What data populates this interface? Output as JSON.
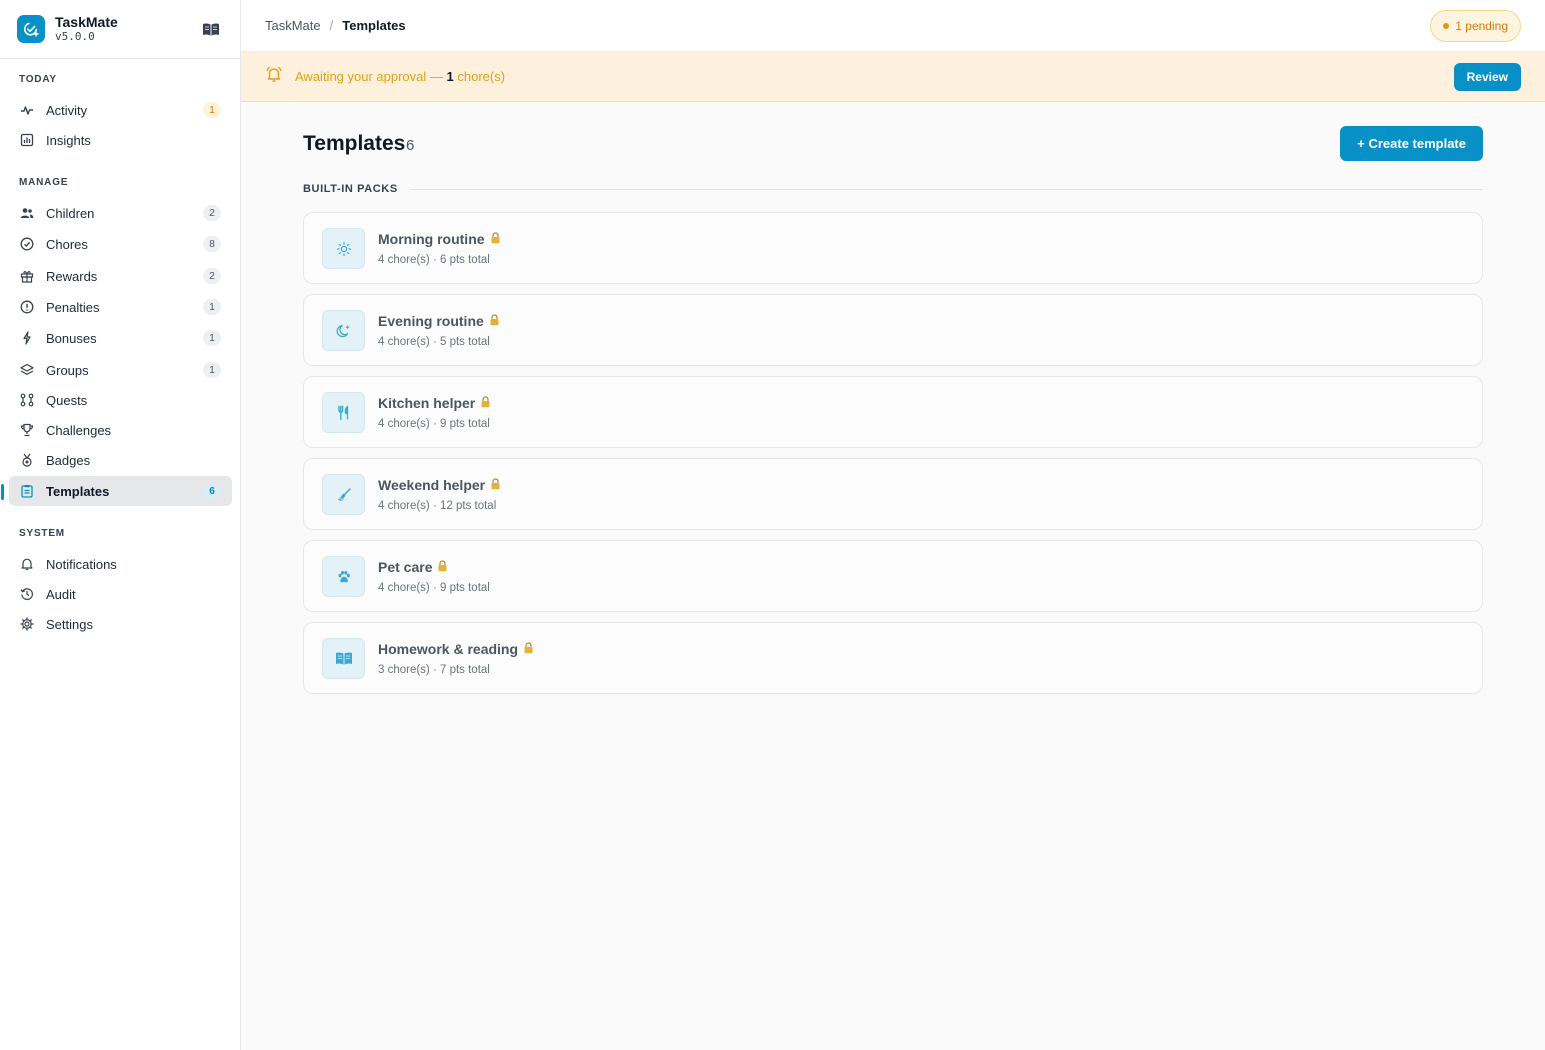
{
  "app": {
    "name": "TaskMate",
    "version": "v5.0.0"
  },
  "sidebar": {
    "sections": [
      {
        "label": "TODAY",
        "items": [
          {
            "label": "Activity",
            "count": "1",
            "icon": "activity-icon"
          },
          {
            "label": "Insights",
            "count": "",
            "icon": "chart-icon"
          }
        ]
      },
      {
        "label": "MANAGE",
        "items": [
          {
            "label": "Children",
            "count": "2",
            "icon": "users-icon"
          },
          {
            "label": "Chores",
            "count": "8",
            "icon": "check-circle-icon"
          },
          {
            "label": "Rewards",
            "count": "2",
            "icon": "gift-icon"
          },
          {
            "label": "Penalties",
            "count": "1",
            "icon": "alert-circle-icon"
          },
          {
            "label": "Bonuses",
            "count": "1",
            "icon": "bolt-icon"
          },
          {
            "label": "Groups",
            "count": "1",
            "icon": "layers-icon"
          },
          {
            "label": "Quests",
            "count": "",
            "icon": "route-icon"
          },
          {
            "label": "Challenges",
            "count": "",
            "icon": "trophy-icon"
          },
          {
            "label": "Badges",
            "count": "",
            "icon": "medal-icon"
          },
          {
            "label": "Templates",
            "count": "6",
            "icon": "clipboard-icon",
            "active": true
          }
        ]
      },
      {
        "label": "SYSTEM",
        "items": [
          {
            "label": "Notifications",
            "count": "",
            "icon": "bell-icon"
          },
          {
            "label": "Audit",
            "count": "",
            "icon": "history-icon"
          },
          {
            "label": "Settings",
            "count": "",
            "icon": "gear-icon"
          }
        ]
      }
    ]
  },
  "topbar": {
    "breadcrumb_root": "TaskMate",
    "breadcrumb_sep": "/",
    "breadcrumb_current": "Templates",
    "pending_label": "1 pending"
  },
  "banner": {
    "text_before": "Awaiting your approval — ",
    "count": "1",
    "text_after": " chore(s)",
    "button_label": "Review"
  },
  "page": {
    "title": "Templates",
    "count": "6",
    "create_label": "+ Create template",
    "group_label": "BUILT-IN PACKS"
  },
  "templates": [
    {
      "name": "Morning routine",
      "meta": "4 chore(s) · 6 pts total",
      "icon": "sun-icon"
    },
    {
      "name": "Evening routine",
      "meta": "4 chore(s) · 5 pts total",
      "icon": "moon-icon"
    },
    {
      "name": "Kitchen helper",
      "meta": "4 chore(s) · 9 pts total",
      "icon": "utensils-icon"
    },
    {
      "name": "Weekend helper",
      "meta": "4 chore(s) · 12 pts total",
      "icon": "broom-icon"
    },
    {
      "name": "Pet care",
      "meta": "4 chore(s) · 9 pts total",
      "icon": "paw-icon"
    },
    {
      "name": "Homework & reading",
      "meta": "3 chore(s) · 7 pts total",
      "icon": "book-icon"
    }
  ],
  "colors": {
    "accent": "#0891c7",
    "warning": "#d97706",
    "banner_bg": "#fdf1dd"
  }
}
